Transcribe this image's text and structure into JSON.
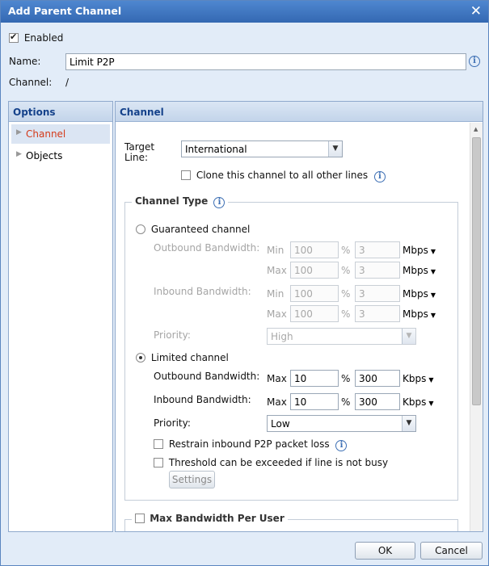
{
  "dialog": {
    "title": "Add Parent Channel"
  },
  "general": {
    "enabled_label": "Enabled",
    "name_label": "Name:",
    "name_value": "Limit P2P",
    "channel_label": "Channel:",
    "channel_value": "/"
  },
  "options_panel": {
    "header": "Options",
    "items": [
      {
        "label": "Channel"
      },
      {
        "label": "Objects"
      }
    ]
  },
  "channel_panel": {
    "header": "Channel",
    "target_line_label_1": "Target",
    "target_line_label_2": "Line:",
    "target_line_value": "International",
    "clone_label": "Clone this channel to all other lines"
  },
  "channel_type": {
    "legend": "Channel Type",
    "guaranteed": {
      "label": "Guaranteed channel",
      "outbound_label": "Outbound Bandwidth:",
      "inbound_label": "Inbound Bandwidth:",
      "min_label": "Min",
      "max_label": "Max",
      "percent": "%",
      "unit": "Mbps",
      "outbound_min_pct": "100",
      "outbound_min_val": "3",
      "outbound_max_pct": "100",
      "outbound_max_val": "3",
      "inbound_min_pct": "100",
      "inbound_min_val": "3",
      "inbound_max_pct": "100",
      "inbound_max_val": "3",
      "priority_label": "Priority:",
      "priority_value": "High"
    },
    "limited": {
      "label": "Limited channel",
      "outbound_label": "Outbound Bandwidth:",
      "inbound_label": "Inbound Bandwidth:",
      "max_label": "Max",
      "percent": "%",
      "unit": "Kbps",
      "outbound_pct": "10",
      "outbound_val": "300",
      "inbound_pct": "10",
      "inbound_val": "300",
      "priority_label": "Priority:",
      "priority_value": "Low",
      "restrain_label": "Restrain inbound P2P packet loss",
      "threshold_label": "Threshold can be exceeded if line is not busy",
      "settings_button": "Settings"
    }
  },
  "max_bw_per_user": {
    "legend": "Max Bandwidth Per User"
  },
  "footer": {
    "ok": "OK",
    "cancel": "Cancel"
  },
  "colors": {
    "title_bar": "#3d72bf",
    "accent": "#15428b",
    "selected_nav_text": "#d43a1a"
  }
}
